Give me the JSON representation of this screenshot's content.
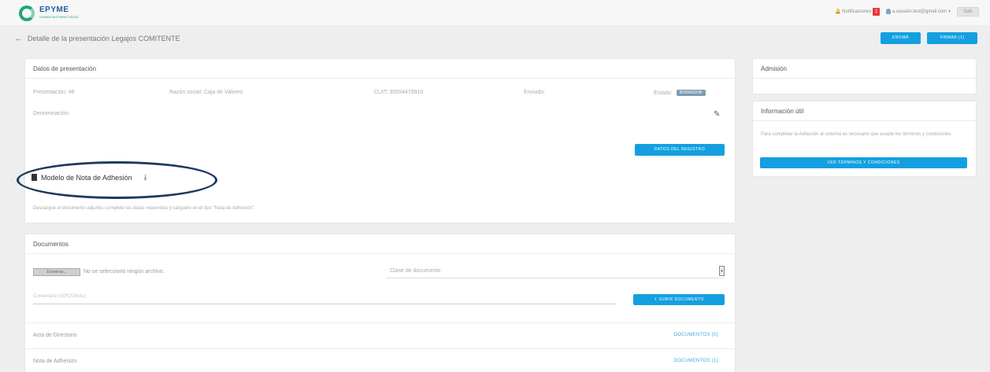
{
  "brand": {
    "name": "EPYME",
    "tagline": "GARANTIAS PARA TODOS"
  },
  "topbar": {
    "notifications_label": "Notificaciones",
    "notifications_count": "1",
    "user_email": "a.usuario.test@gmail.com",
    "exit_label": "Salir"
  },
  "page": {
    "title": "Detalle de la presentación Legajos COMITENTE",
    "buttons": {
      "enviar": "ENVIAR",
      "firmar": "FIRMAR (1)"
    }
  },
  "datos": {
    "header": "Datos de presentación",
    "presentacion": "Presentación: 46",
    "razon_social": "Razón social: Caja de Valores",
    "cuit": "CUIT: 30554479910",
    "enviado": "Enviado:",
    "estado_label": "Estado:",
    "estado_value": "BORRADOR",
    "denominacion": "Denominación:",
    "registro_button": "DATOS DEL REGISTRO",
    "modelo_label": "Modelo de Nota de Adhesión",
    "helper_text": "Descargue el documento adjunto, complete los datos requeridos y cárguelo en el tipo \"Nota de Adhesión\"."
  },
  "documentos": {
    "header": "Documentos",
    "file_button": "Examinar...",
    "file_status": "No se seleccionó ningún archivo.",
    "clase_placeholder": "Clase de documento",
    "comment_placeholder": "Comentario (OPCIONAL)",
    "subir_button": "SUBIR DOCUMENTO",
    "rows": [
      {
        "label": "Acta de Directorio",
        "link": "DOCUMENTOS (0)"
      },
      {
        "label": "Nota de Adhesión",
        "link": "DOCUMENTOS (1)"
      }
    ]
  },
  "admision": {
    "header": "Admisión"
  },
  "info": {
    "header": "Información útil",
    "text": "Para completar la Adhesión al sistema es necesario que acepte los términos y condiciones.",
    "button": "VER TÉRMINOS Y CONDICIONES"
  },
  "colors": {
    "accent": "#14a0e0",
    "brand_green": "#1fa67a",
    "annotation": "#1e3a5f"
  }
}
